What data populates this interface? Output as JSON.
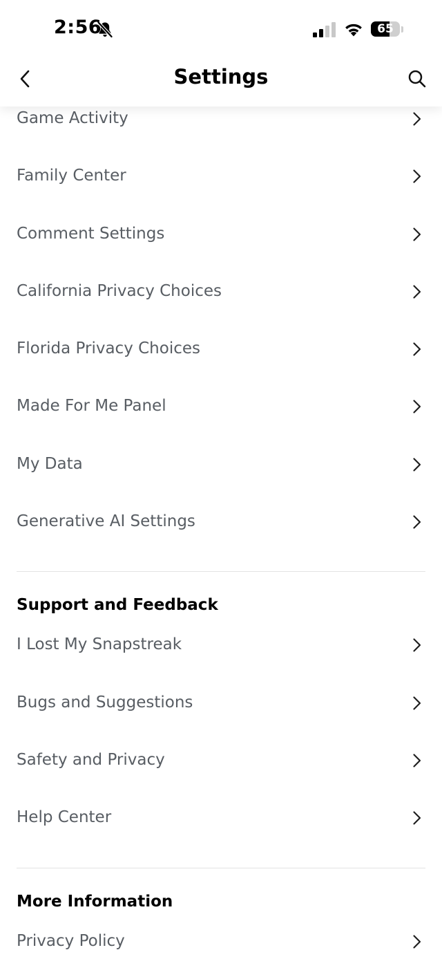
{
  "status_bar": {
    "time": "2:56",
    "battery_level": "65",
    "battery_fraction": 0.65,
    "icons": [
      "bell-slash-icon",
      "cellular-signal-icon",
      "wifi-icon",
      "battery-icon"
    ]
  },
  "header": {
    "title": "Settings",
    "back_icon": "chevron-left-icon",
    "search_icon": "search-icon"
  },
  "colors": {
    "row_text": "#585d63",
    "header_text": "#000000",
    "chevron": "#1f1f1f",
    "divider": "#e3e3e3"
  },
  "privacy_items": [
    {
      "label": "Game Activity"
    },
    {
      "label": "Family Center"
    },
    {
      "label": "Comment Settings"
    },
    {
      "label": "California Privacy Choices"
    },
    {
      "label": "Florida Privacy Choices"
    },
    {
      "label": "Made For Me Panel"
    },
    {
      "label": "My Data"
    },
    {
      "label": "Generative AI Settings"
    }
  ],
  "support_section": {
    "title": "Support and Feedback",
    "items": [
      {
        "label": "I Lost My Snapstreak"
      },
      {
        "label": "Bugs and Suggestions"
      },
      {
        "label": "Safety and Privacy"
      },
      {
        "label": "Help Center"
      }
    ]
  },
  "more_info_section": {
    "title": "More Information",
    "items": [
      {
        "label": "Privacy Policy"
      }
    ]
  }
}
